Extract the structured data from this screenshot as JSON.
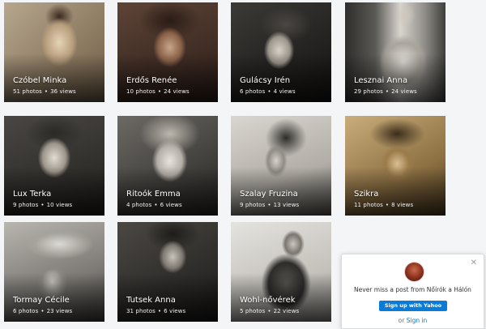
{
  "albums": [
    {
      "title": "Czóbel Minka",
      "photos": "51 photos",
      "views": "36 views"
    },
    {
      "title": "Erdős Renée",
      "photos": "10 photos",
      "views": "24 views"
    },
    {
      "title": "Gulácsy Irén",
      "photos": "6 photos",
      "views": "4 views"
    },
    {
      "title": "Lesznai Anna",
      "photos": "29 photos",
      "views": "24 views"
    },
    {
      "title": "Lux Terka",
      "photos": "9 photos",
      "views": "10 views"
    },
    {
      "title": "Ritoók Emma",
      "photos": "4 photos",
      "views": "6 views"
    },
    {
      "title": "Szalay Fruzina",
      "photos": "9 photos",
      "views": "13 views"
    },
    {
      "title": "Szikra",
      "photos": "11 photos",
      "views": "8 views"
    },
    {
      "title": "Tormay Cécile",
      "photos": "6 photos",
      "views": "23 views"
    },
    {
      "title": "Tutsek Anna",
      "photos": "31 photos",
      "views": "6 views"
    },
    {
      "title": "Wohl-nővérek",
      "photos": "5 photos",
      "views": "22 views"
    }
  ],
  "stats_separator": "•",
  "popup": {
    "close_glyph": "✕",
    "message": "Never miss a post from Nőírók a Hálón",
    "signup_label": "Sign up with Yahoo",
    "or_text": "or",
    "signin_label": "Sign in"
  },
  "colors": {
    "accent": "#0a7bd6",
    "background": "#f4f5f6"
  }
}
